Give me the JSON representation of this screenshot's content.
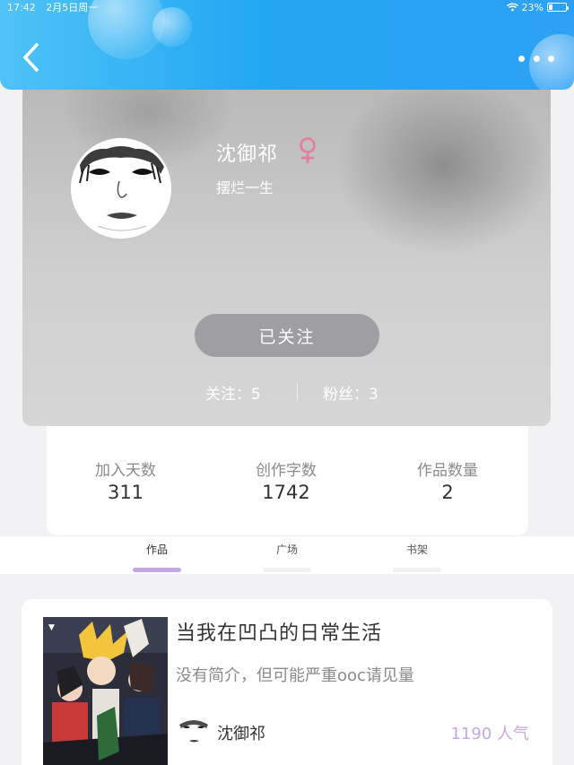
{
  "status_bar": {
    "time": "17:42",
    "date": "2月5日周一",
    "battery": "23%",
    "battery_level": 0.23
  },
  "header": {
    "back_icon": "chevron-left-icon",
    "more_icon": "more-dots-icon"
  },
  "profile": {
    "name": "沈御祁",
    "gender_icon": "female-symbol-icon",
    "gender_color": "#e87a9a",
    "signature": "摆烂一生",
    "follow_label": "已关注",
    "following_label": "关注：5",
    "fans_label": "粉丝：3"
  },
  "stats": [
    {
      "label": "加入天数",
      "value": "311"
    },
    {
      "label": "创作字数",
      "value": "1742"
    },
    {
      "label": "作品数量",
      "value": "2"
    }
  ],
  "tabs": [
    {
      "label": "作品",
      "active": true
    },
    {
      "label": "广场",
      "active": false
    },
    {
      "label": "书架",
      "active": false
    }
  ],
  "works": [
    {
      "title": "当我在凹凸的日常生活",
      "description": "没有简介，但可能严重ooc请见量",
      "author": "沈御祁",
      "popularity": "1190 人气"
    }
  ],
  "colors": {
    "header_blue": "#22a7f2",
    "accent_purple": "#c7a7e3"
  }
}
